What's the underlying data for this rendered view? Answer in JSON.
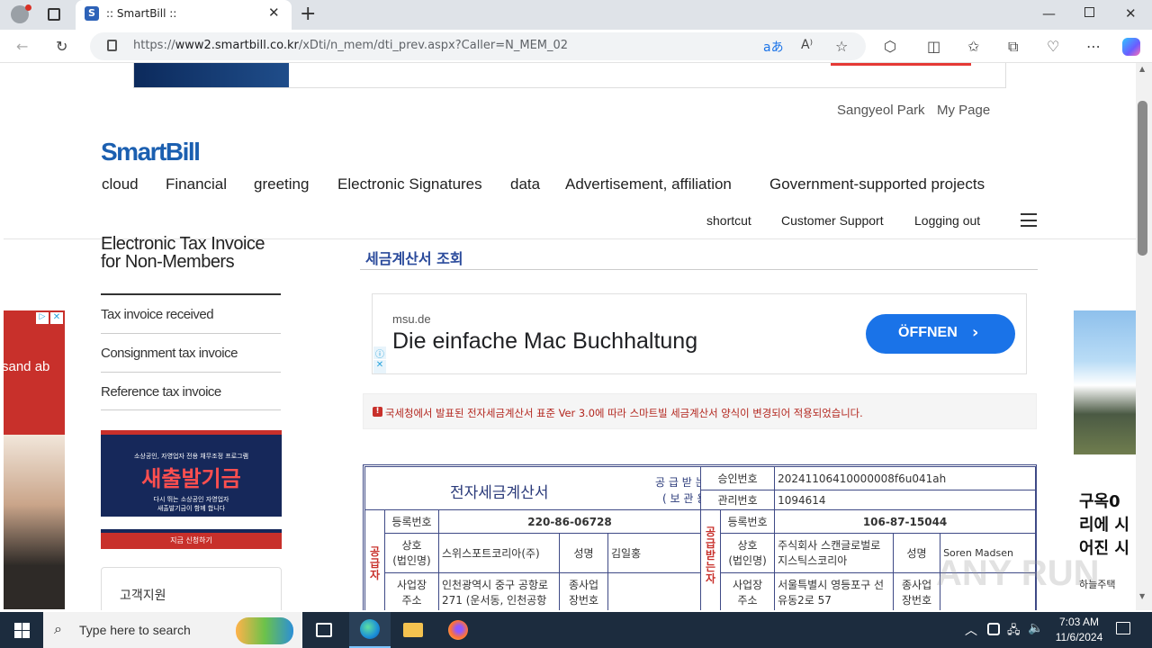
{
  "browser": {
    "tab_title": ":: SmartBill ::",
    "tab_favicon": "S",
    "url_prefix": "https://",
    "url_domain": "www2.smartbill.co.kr",
    "url_path": "/xDti/n_mem/dti_prev.aspx?Caller=N_MEM_02"
  },
  "header": {
    "logo": "SmartBill",
    "user_name": "Sangyeol Park",
    "my_page": "My Page",
    "nav": [
      "cloud",
      "Financial",
      "greeting",
      "Electronic Signatures",
      "data",
      "Advertisement, affiliation",
      "Government-supported projects"
    ],
    "subnav": [
      "shortcut",
      "Customer Support",
      "Logging out"
    ]
  },
  "sidebar": {
    "title_line1": "Electronic Tax Invoice",
    "title_line2": "for Non-Members",
    "items": [
      "Tax invoice received",
      "Consignment tax invoice",
      "Reference tax invoice"
    ],
    "banner": {
      "top": "소상공인, 자영업자 전용 채무조정 프로그램",
      "title": "새출발기금",
      "sub1": "다시 뛰는 소상공인 자영업자",
      "sub2": "새출발기금이 함께 합니다",
      "cta": "지금 신청하기"
    },
    "support_title": "고객지원"
  },
  "main": {
    "title": "세금계산서 조회",
    "ad": {
      "domain": "msu.de",
      "headline": "Die einfache Mac Buchhaltung",
      "button": "ÖFFNEN"
    },
    "notice": "국세청에서 발표된 전자세금계산서 표준 Ver 3.0에 따라 스마트빌 세금계산서 양식이 변경되어 적용되었습니다."
  },
  "invoice": {
    "title": "전자세금계산서",
    "receiver_line1": "공 급 받 는 자",
    "receiver_line2": "( 보 관 용 )",
    "approval_label": "승인번호",
    "approval_no": "20241106410000008f6u041ah",
    "mgmt_label": "관리번호",
    "mgmt_no": "1094614",
    "supplier_side": "공급자",
    "receiver_side": "공급받는자",
    "reg_label": "등록번호",
    "company_label_1": "상호",
    "company_label_2": "(법인명)",
    "name_label": "성명",
    "addr_label_1": "사업장",
    "addr_label_2": "주소",
    "branch_label_1": "종사업",
    "branch_label_2": "장번호",
    "supplier": {
      "reg_no": "220-86-06728",
      "company": "스위스포트코리아(주)",
      "name": "김일홍",
      "address": "인천광역시 중구 공항로 271 (운서동, 인천공항"
    },
    "receiver": {
      "reg_no": "106-87-15044",
      "company": "주식회사 스캔글로벌로지스틱스코리아",
      "name": "Soren Madsen",
      "address": "서울특별시 영등포구 선유동2로 57"
    }
  },
  "side_ad_left": {
    "text": "sand ab"
  },
  "side_ad_right": {
    "line1": "구옥0",
    "line2": "리에 시",
    "line3": "어진 시",
    "line4": "하늘주택"
  },
  "watermark": "ANY RUN",
  "taskbar": {
    "search_placeholder": "Type here to search",
    "time": "7:03 AM",
    "date": "11/6/2024"
  },
  "colors": {
    "brand_blue": "#1b5fb0",
    "table_border": "#3f4a86",
    "notice_red": "#b3261e",
    "ad_button": "#1a73e8"
  }
}
